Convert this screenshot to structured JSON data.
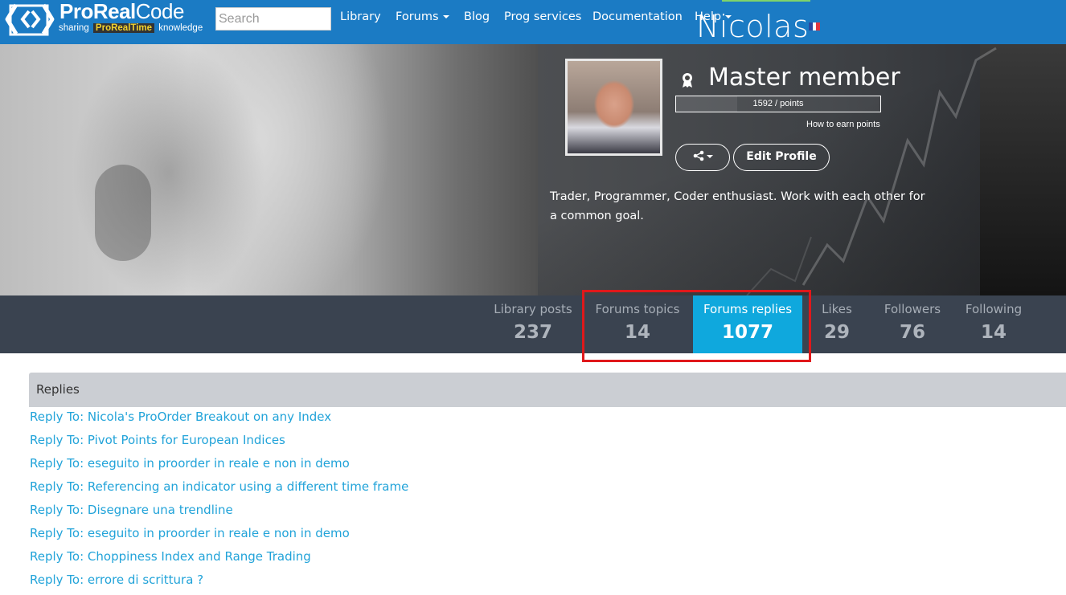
{
  "brand": {
    "title_bold": "ProReal",
    "title_thin": "Code",
    "sub_before": "sharing",
    "sub_highlight": "ProRealTime",
    "sub_after": "knowledge"
  },
  "search": {
    "placeholder": "Search",
    "value": ""
  },
  "nav": {
    "library": "Library",
    "forums": "Forums",
    "blog": "Blog",
    "prog_services": "Prog services",
    "documentation": "Documentation",
    "help": "Help"
  },
  "profile": {
    "name": "Nicolas",
    "country_flag_colors": [
      "#2a49a1",
      "#ffffff",
      "#e3373e"
    ],
    "rank": "Master member",
    "points_text": "1592 / points",
    "points_fraction": 0.3,
    "how_to_earn": "How to earn points",
    "share_icon": "share-icon",
    "edit_button": "Edit Profile",
    "bio": "Trader, Programmer, Coder enthusiast. Work with each other for a common goal."
  },
  "stats": {
    "library_posts": {
      "label": "Library posts",
      "count": "237"
    },
    "forums_topics": {
      "label": "Forums topics",
      "count": "14"
    },
    "forums_replies": {
      "label": "Forums replies",
      "count": "1077"
    },
    "likes": {
      "label": "Likes",
      "count": "29"
    },
    "followers": {
      "label": "Followers",
      "count": "76"
    },
    "following": {
      "label": "Following",
      "count": "14"
    }
  },
  "colors": {
    "navbar": "#1b7bc4",
    "stats_bg": "#3a4350",
    "active_stat": "#0fa8dd",
    "highlight_border": "#e0181b",
    "link": "#21a3d9"
  },
  "replies": {
    "title": "Replies",
    "items": [
      "Reply To: Nicola's ProOrder Breakout on any Index",
      "Reply To: Pivot Points for European Indices",
      "Reply To: eseguito in proorder in reale e non in demo",
      "Reply To: Referencing an indicator using a different time frame",
      "Reply To: Disegnare una trendline",
      "Reply To: eseguito in proorder in reale e non in demo",
      "Reply To: Choppiness Index and Range Trading",
      "Reply To: errore di scrittura ?"
    ]
  }
}
